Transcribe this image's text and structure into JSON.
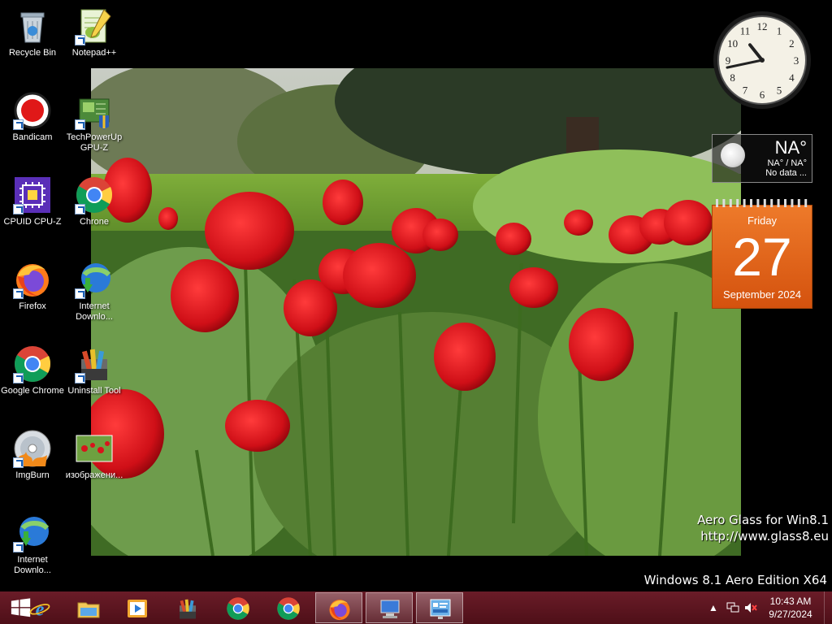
{
  "desktop": {
    "icons": [
      {
        "label": "Recycle Bin",
        "icon": "recycle-bin-icon"
      },
      {
        "label": "Notepad++",
        "icon": "notepad-plus-plus-icon"
      },
      {
        "label": "Bandicam",
        "icon": "bandicam-icon"
      },
      {
        "label": "TechPowerUp GPU-Z",
        "icon": "gpu-z-icon"
      },
      {
        "label": "CPUID CPU-Z",
        "icon": "cpu-z-icon"
      },
      {
        "label": "Chrone",
        "icon": "chrome-icon"
      },
      {
        "label": "Firefox",
        "icon": "firefox-icon"
      },
      {
        "label": "Internet Downlo...",
        "icon": "internet-download-manager-icon"
      },
      {
        "label": "Google Chrome",
        "icon": "chrome-icon"
      },
      {
        "label": "Uninstall Tool",
        "icon": "uninstall-tool-icon"
      },
      {
        "label": "ImgBurn",
        "icon": "imgburn-icon"
      },
      {
        "label": "изображени...",
        "icon": "image-file-icon"
      },
      {
        "label": "Internet Downlo...",
        "icon": "internet-download-manager-icon"
      }
    ]
  },
  "gadgets": {
    "clock": {
      "hour": 10,
      "minute": 43,
      "numbers": [
        "12",
        "1",
        "2",
        "3",
        "4",
        "5",
        "6",
        "7",
        "8",
        "9",
        "10",
        "11"
      ]
    },
    "weather": {
      "temperature": "NA°",
      "range": "NA° / NA°",
      "status": "No data ..."
    },
    "calendar": {
      "weekday": "Friday",
      "day": "27",
      "month_year": "September 2024"
    }
  },
  "watermark": {
    "line1": "Aero Glass for Win8.1",
    "line2": "http://www.glass8.eu"
  },
  "edition": "Windows 8.1 Aero Edition X64",
  "taskbar": {
    "buttons": [
      {
        "name": "internet-explorer-taskbar-button",
        "icon": "internet-explorer-icon",
        "active": false
      },
      {
        "name": "file-explorer-taskbar-button",
        "icon": "folder-icon",
        "active": false
      },
      {
        "name": "media-player-taskbar-button",
        "icon": "media-player-icon",
        "active": false
      },
      {
        "name": "uninstall-tool-taskbar-button",
        "icon": "uninstall-tool-icon",
        "active": false
      },
      {
        "name": "chrome-taskbar-button",
        "icon": "chrome-icon",
        "active": false
      },
      {
        "name": "chrome-alt-taskbar-button",
        "icon": "chrome-icon",
        "active": false
      },
      {
        "name": "firefox-taskbar-button",
        "icon": "firefox-icon",
        "active": true
      },
      {
        "name": "remote-app-taskbar-button",
        "icon": "computer-icon",
        "active": true
      },
      {
        "name": "control-panel-taskbar-button",
        "icon": "control-panel-icon",
        "active": true
      }
    ],
    "tray": {
      "chevron": "▲",
      "time": "10:43 AM",
      "date": "9/27/2024"
    }
  },
  "colors": {
    "taskbar": "#5e1622",
    "calendar": "#e2661c",
    "accent_tulip": "#d8141c"
  }
}
